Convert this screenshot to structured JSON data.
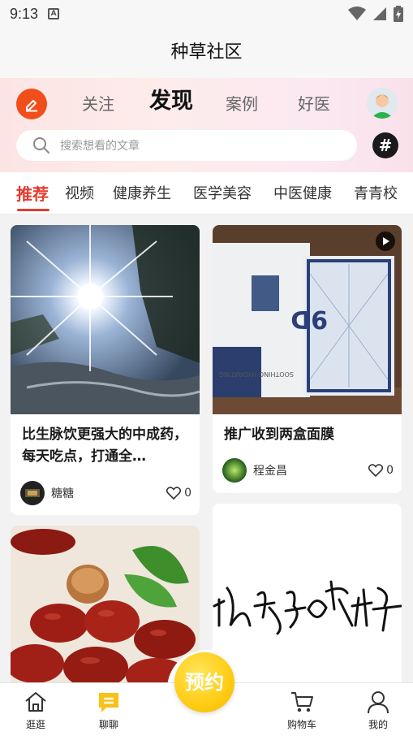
{
  "status_bar": {
    "time": "9:13",
    "notification_icon": "a-notification-icon",
    "icons": [
      "wifi-icon",
      "signal-icon",
      "battery-icon"
    ]
  },
  "app": {
    "title": "种草社区"
  },
  "header": {
    "tabs": [
      {
        "label": "关注",
        "active": false
      },
      {
        "label": "发现",
        "active": true
      },
      {
        "label": "案例",
        "active": false
      },
      {
        "label": "好医",
        "active": false
      }
    ],
    "search_placeholder": "搜索想看的文章",
    "hash_symbol": "#",
    "accent": "#f04e1a"
  },
  "categories": [
    "推荐",
    "视频",
    "健康养生",
    "医学美容",
    "中医健康",
    "青青校"
  ],
  "active_category_color": "#e53b2c",
  "feed": [
    {
      "title": "比生脉饮更强大的中成药，每天吃点，打通全…",
      "author": "糖糖",
      "likes": "0",
      "image": "sunburst-landscape-photo"
    },
    {
      "title": "推广收到两盒面膜",
      "author": "程金昌",
      "likes": "0",
      "image": "facial-mask-boxes-photo",
      "video": true
    },
    {
      "title": "",
      "author": "",
      "likes": "",
      "image": "red-dates-photo"
    },
    {
      "title": "",
      "author": "",
      "likes": "",
      "image": "handwritten-calligraphy-image"
    }
  ],
  "bottom_nav": {
    "items": [
      {
        "label": "逛逛",
        "icon": "home-icon"
      },
      {
        "label": "聊聊",
        "icon": "chat-icon",
        "active": true
      },
      {
        "label": "购物车",
        "icon": "cart-icon"
      },
      {
        "label": "我的",
        "icon": "user-icon"
      }
    ],
    "fab_label": "预约"
  }
}
